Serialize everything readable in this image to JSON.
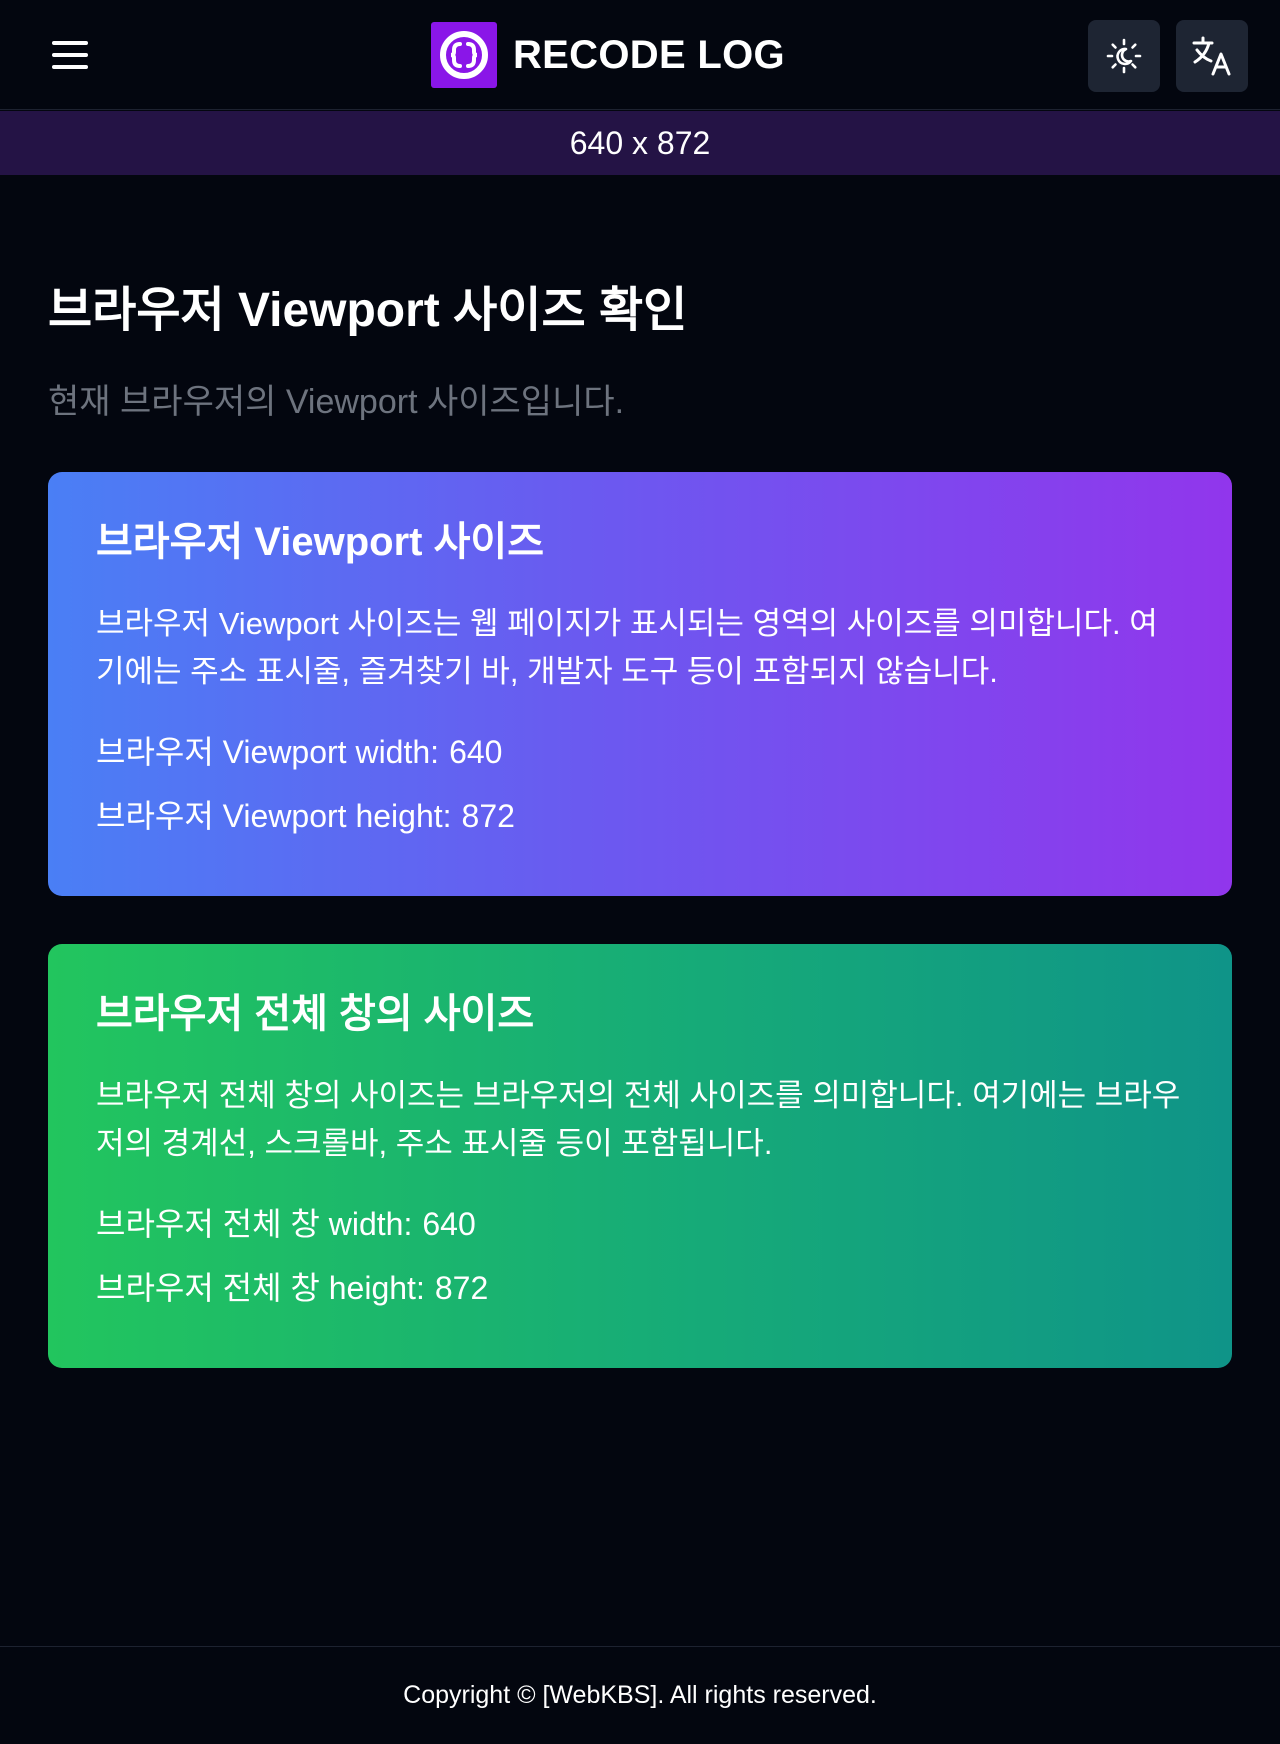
{
  "header": {
    "menu_icon": "hamburger-menu-icon",
    "logo_icon": "braces-logo-icon",
    "brand": "RECODE LOG",
    "theme_icon": "sun-moon-icon",
    "language_icon": "translate-icon",
    "logo_color": "#8a16e8"
  },
  "size_bar": {
    "text": "640 x 872",
    "background": "#241345"
  },
  "main": {
    "title": "브라우저 Viewport 사이즈 확인",
    "subtitle": "현재 브라우저의 Viewport 사이즈입니다."
  },
  "viewport_card": {
    "title": "브라우저 Viewport 사이즈",
    "description": "브라우저 Viewport 사이즈는 웹 페이지가 표시되는 영역의 사이즈를 의미합니다. 여기에는 주소 표시줄, 즐겨찾기 바, 개발자 도구 등이 포함되지 않습니다.",
    "width_label": "브라우저 Viewport width:",
    "width_value": "640",
    "height_label": "브라우저 Viewport height:",
    "height_value": "872",
    "gradient": [
      "#4a7ff5",
      "#9136ec"
    ]
  },
  "window_card": {
    "title": "브라우저 전체 창의 사이즈",
    "description": "브라우저 전체 창의 사이즈는 브라우저의 전체 사이즈를 의미합니다. 여기에는 브라우저의 경계선, 스크롤바, 주소 표시줄 등이 포함됩니다.",
    "width_label": "브라우저 전체 창 width:",
    "width_value": "640",
    "height_label": "브라우저 전체 창 height:",
    "height_value": "872",
    "gradient": [
      "#22c55e",
      "#0f9488"
    ]
  },
  "footer": {
    "text": "Copyright © [WebKBS]. All rights reserved."
  }
}
